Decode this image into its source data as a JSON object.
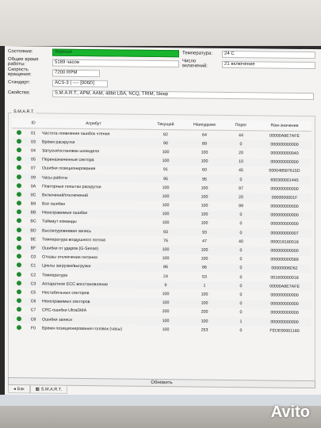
{
  "info": {
    "status_label": "Состояние:",
    "status_value": "Хорошо",
    "temp_label": "Температура:",
    "temp_value": "24 C",
    "hours_label": "Общее время работы:",
    "hours_value": "5189 часов",
    "powercount_label": "Число включений:",
    "powercount_value": "21 включение",
    "rpm_label": "Скорость вращения:",
    "rpm_value": "7200 RPM",
    "standard_label": "Стандарт:",
    "standard_value": "ACS-3 | ---- [006D]",
    "features_label": "Свойства:",
    "features_value": "S.M.A.R.T., APM, AAM, 48bit LBA, NCQ, TRIM, Sleep"
  },
  "smart": {
    "group_title": "S.M.A.R.T.",
    "columns": [
      "ID",
      "Атрибут",
      "Текущий",
      "Наихудшее",
      "Порог",
      "Raw-значение"
    ],
    "rows": [
      {
        "id": "01",
        "name": "Частота появления ошибок чтения",
        "cur": "82",
        "worst": "64",
        "thr": "44",
        "raw": "00000A8E7AFE"
      },
      {
        "id": "03",
        "name": "Время раскрутки",
        "cur": "90",
        "worst": "89",
        "thr": "0",
        "raw": "000000000000"
      },
      {
        "id": "04",
        "name": "Запуски/остановки шпинделя",
        "cur": "100",
        "worst": "100",
        "thr": "20",
        "raw": "000000000040"
      },
      {
        "id": "05",
        "name": "Переназначенные сектора",
        "cur": "100",
        "worst": "100",
        "thr": "10",
        "raw": "000000000000"
      },
      {
        "id": "07",
        "name": "Ошибки позиционирования",
        "cur": "91",
        "worst": "60",
        "thr": "45",
        "raw": "000048587615D"
      },
      {
        "id": "09",
        "name": "Часы работы",
        "cur": "95",
        "worst": "95",
        "thr": "0",
        "raw": "830300001445"
      },
      {
        "id": "0A",
        "name": "Повторные попытки раскрутки",
        "cur": "100",
        "worst": "100",
        "thr": "97",
        "raw": "000000000000"
      },
      {
        "id": "0C",
        "name": "Включений/отключений",
        "cur": "100",
        "worst": "100",
        "thr": "20",
        "raw": "0000000001F"
      },
      {
        "id": "B8",
        "name": "Все ошибки",
        "cur": "100",
        "worst": "100",
        "thr": "99",
        "raw": "000000000000"
      },
      {
        "id": "BB",
        "name": "Неисправимые ошибки",
        "cur": "100",
        "worst": "100",
        "thr": "0",
        "raw": "000000000000"
      },
      {
        "id": "BC",
        "name": "Таймаут команды",
        "cur": "100",
        "worst": "100",
        "thr": "0",
        "raw": "000000000000"
      },
      {
        "id": "BD",
        "name": "Высокоуровневая запись",
        "cur": "93",
        "worst": "93",
        "thr": "0",
        "raw": "000000000007"
      },
      {
        "id": "BE",
        "name": "Температура воздушного потока",
        "cur": "76",
        "worst": "47",
        "thr": "40",
        "raw": "000018180018"
      },
      {
        "id": "BF",
        "name": "Ошибки от ударов (G-Sense)",
        "cur": "100",
        "worst": "100",
        "thr": "0",
        "raw": "000000000000"
      },
      {
        "id": "C0",
        "name": "Отказы отключения питания",
        "cur": "100",
        "worst": "100",
        "thr": "0",
        "raw": "000000000589"
      },
      {
        "id": "C1",
        "name": "Циклы загрузки/выгрузки",
        "cur": "86",
        "worst": "86",
        "thr": "0",
        "raw": "00000006D62"
      },
      {
        "id": "C2",
        "name": "Температура",
        "cur": "24",
        "worst": "53",
        "thr": "0",
        "raw": "001600000018"
      },
      {
        "id": "C3",
        "name": "Аппаратное ECC восстановление",
        "cur": "9",
        "worst": "1",
        "thr": "0",
        "raw": "00000A8E7AFE"
      },
      {
        "id": "C5",
        "name": "Нестабильных секторов",
        "cur": "100",
        "worst": "100",
        "thr": "0",
        "raw": "000000000000"
      },
      {
        "id": "C6",
        "name": "Неисправимых секторов",
        "cur": "100",
        "worst": "100",
        "thr": "0",
        "raw": "000000000000"
      },
      {
        "id": "C7",
        "name": "CRC-ошибки UltraDMA",
        "cur": "200",
        "worst": "200",
        "thr": "0",
        "raw": "000000000000"
      },
      {
        "id": "C8",
        "name": "Ошибки записи",
        "cur": "100",
        "worst": "100",
        "thr": "1",
        "raw": "000000000000"
      },
      {
        "id": "F0",
        "name": "Время позиционирования головок (часы)",
        "cur": "100",
        "worst": "253",
        "thr": "0",
        "raw": "FEDE00001180"
      }
    ]
  },
  "refresh_label": "Обновить",
  "tabs": [
    {
      "label": "Бэк"
    },
    {
      "label": "S.M.A.R.T."
    }
  ],
  "status_color": "#19b52e",
  "watermark": "Avito"
}
